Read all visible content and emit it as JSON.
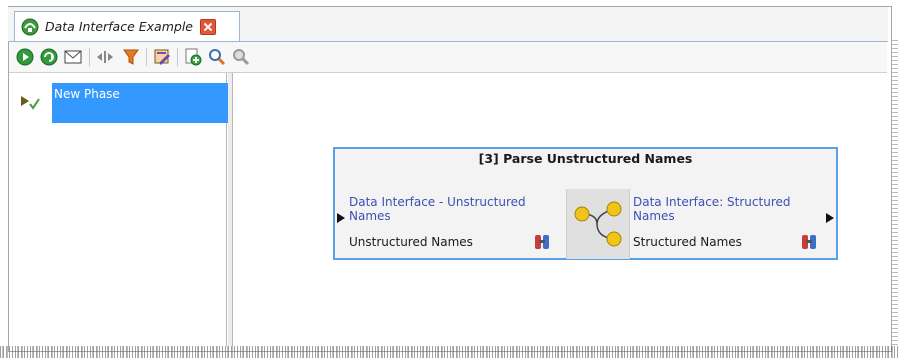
{
  "tab": {
    "title": "Data Interface Example"
  },
  "toolbar": {
    "icons": [
      "run-icon",
      "run-from-here-icon",
      "email-icon",
      "split-icon",
      "filter-icon",
      "edit-icon",
      "add-processor-icon",
      "find-icon",
      "find-disabled-icon"
    ]
  },
  "tree": {
    "phase_label": "New Phase"
  },
  "node": {
    "title": "[3] Parse Unstructured Names",
    "input": {
      "label": "Data Interface - Unstructured Names",
      "type": "Unstructured Names"
    },
    "output": {
      "label": "Data Interface: Structured Names",
      "type": "Structured Names"
    }
  },
  "colors": {
    "selection": "#3399ff",
    "node_border": "#5aa0e6",
    "port_label": "#3f4fb5"
  }
}
